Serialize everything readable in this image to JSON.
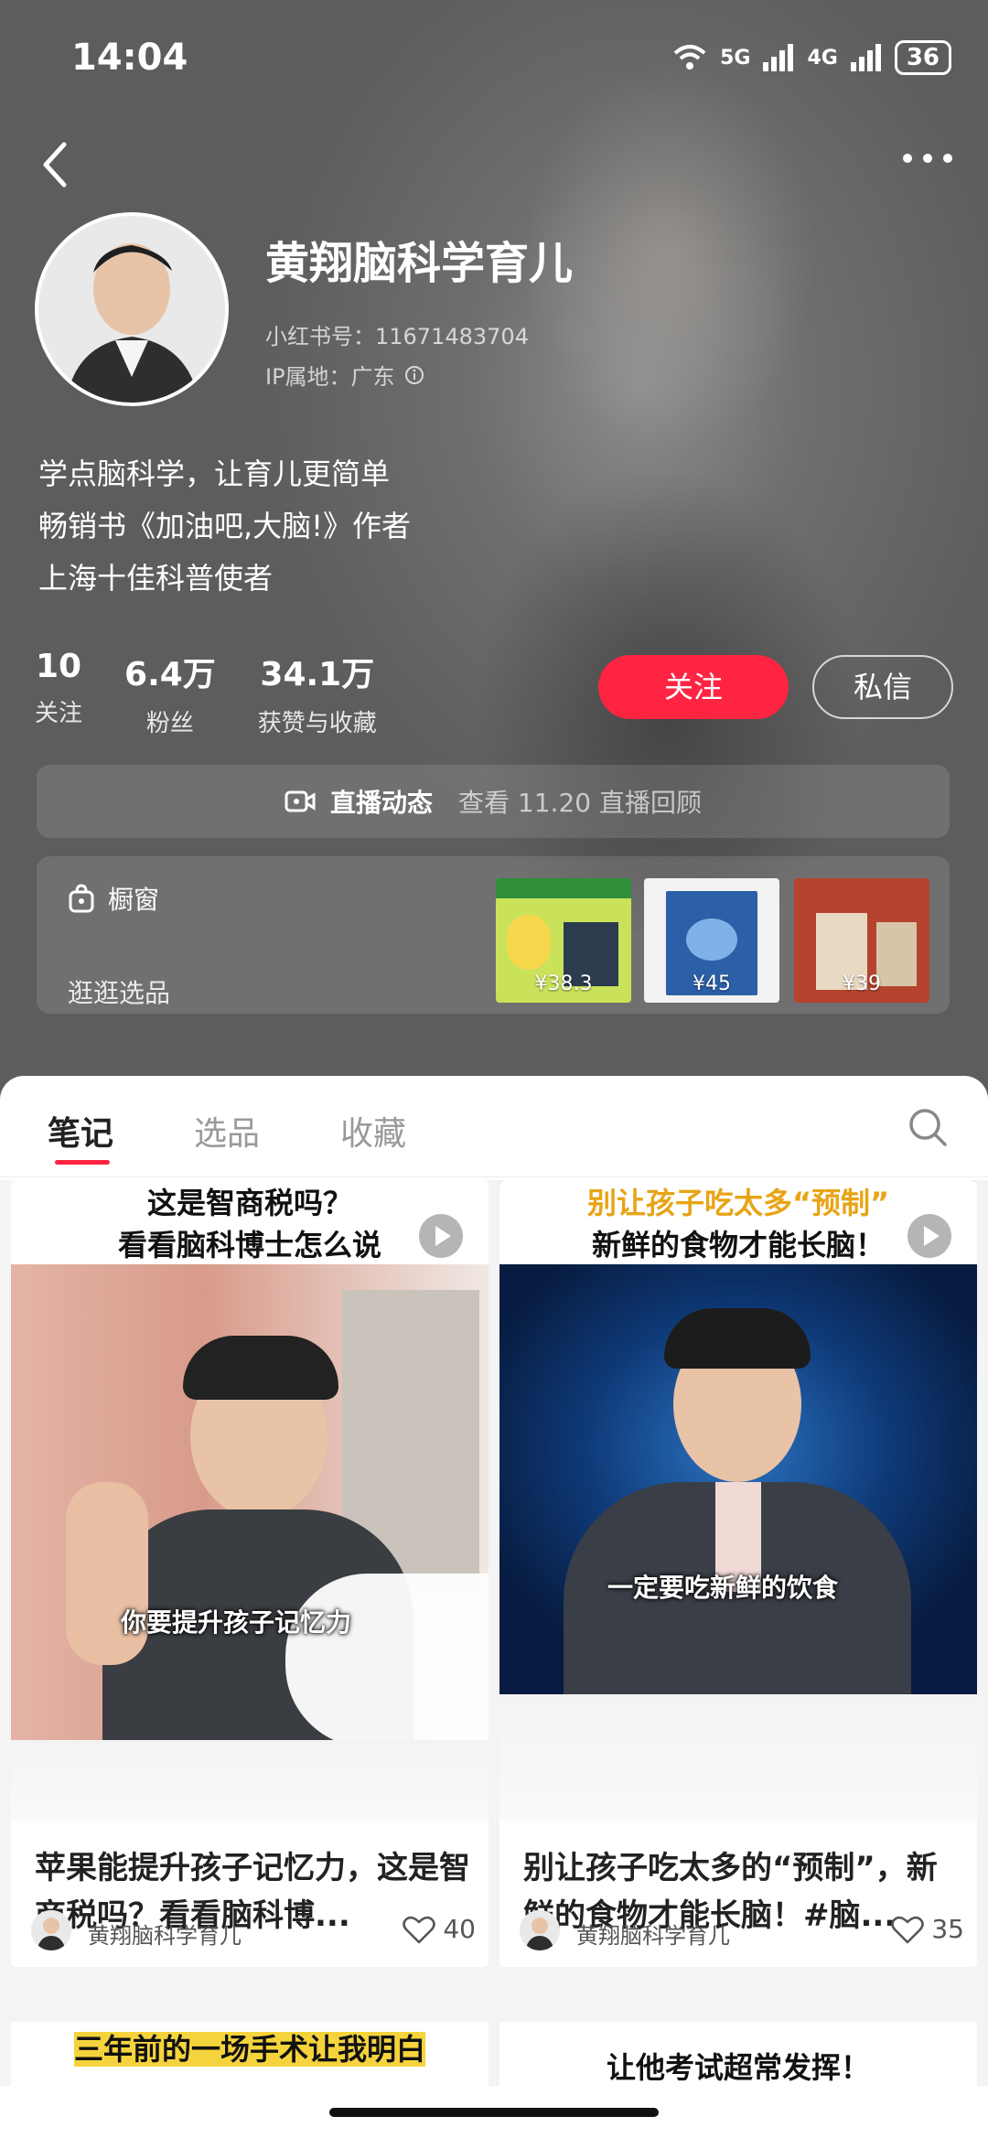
{
  "status": {
    "time": "14:04",
    "net1": "5G",
    "net2": "4G",
    "battery": "36"
  },
  "profile": {
    "name": "黄翔脑科学育儿",
    "id_text": "小红书号：11671483704",
    "ip_text": "IP属地：广东",
    "bio": [
      "学点脑科学，让育儿更简单",
      "畅销书《加油吧,大脑!》作者",
      "上海十佳科普使者"
    ],
    "stats": [
      {
        "num": "10",
        "label": "关注"
      },
      {
        "num": "6.4万",
        "label": "粉丝"
      },
      {
        "num": "34.1万",
        "label": "获赞与收藏"
      }
    ],
    "follow_label": "关注",
    "message_label": "私信"
  },
  "live": {
    "label": "直播动态",
    "sub": "查看 11.20 直播回顾"
  },
  "shop": {
    "title": "橱窗",
    "sub": "逛逛选品",
    "products": [
      {
        "price": "¥38.3",
        "color": "#c9e25a"
      },
      {
        "price": "¥45",
        "color": "#2b5fa8"
      },
      {
        "price": "¥39",
        "color": "#b5432f"
      }
    ]
  },
  "tabs": {
    "notes": "笔记",
    "picks": "选品",
    "favorites": "收藏"
  },
  "posts": [
    {
      "caption": [
        "这是智商税吗？",
        "看看脑科博士怎么说"
      ],
      "overlay": "你要提升孩子记忆力",
      "title": "苹果能提升孩子记忆力，这是智商税吗？看看脑科博...",
      "author": "黄翔脑科学育儿",
      "likes": "40"
    },
    {
      "caption": [
        "别让孩子吃太多“预制”",
        "新鲜的食物才能长脑！"
      ],
      "overlay": "一定要吃新鲜的饮食",
      "title": "别让孩子吃太多的“预制”，新鲜的食物才能长脑！#脑...",
      "author": "黄翔脑科学育儿",
      "likes": "35"
    }
  ],
  "next_posts": [
    "三年前的一场手术让我明白",
    "让他考试超常发挥！"
  ],
  "colors": {
    "accent": "#ff2442"
  }
}
